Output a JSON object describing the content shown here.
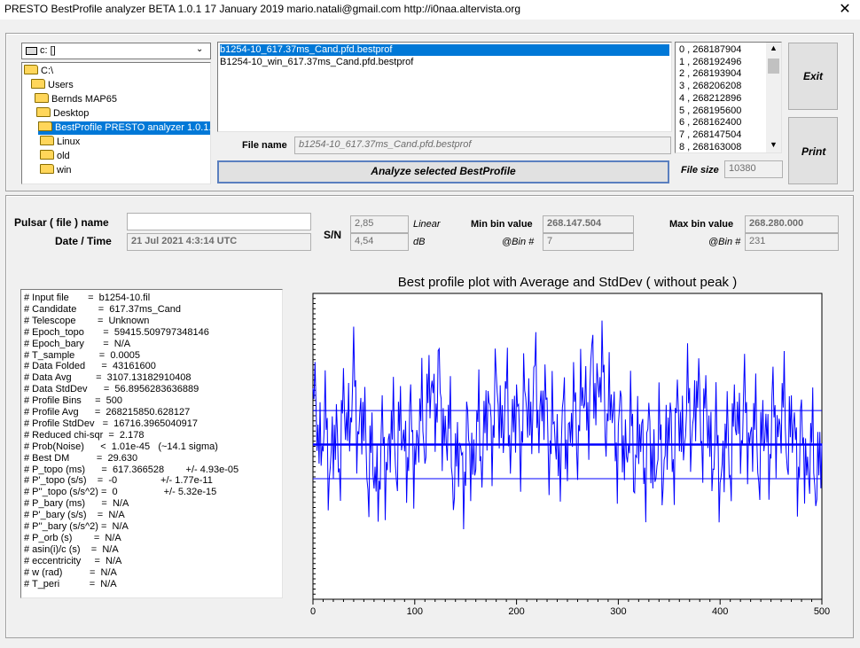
{
  "window": {
    "title": "PRESTO BestProfile analyzer BETA 1.0.1   17 January 2019       mario.natali@gmail.com       http://i0naa.altervista.org",
    "close": "✕"
  },
  "drive": {
    "value": "c: []",
    "arrow": "⌄"
  },
  "dirs": [
    {
      "label": "C:\\",
      "indent": 0,
      "selected": false
    },
    {
      "label": "Users",
      "indent": 1,
      "selected": false
    },
    {
      "label": "Bernds MAP65",
      "indent": 2,
      "selected": false
    },
    {
      "label": "Desktop",
      "indent": 3,
      "selected": false
    },
    {
      "label": "BestProfile PRESTO analyzer 1.0.1.e",
      "indent": 4,
      "selected": true
    },
    {
      "label": "Linux",
      "indent": 5,
      "selected": false
    },
    {
      "label": "old",
      "indent": 5,
      "selected": false
    },
    {
      "label": "win",
      "indent": 5,
      "selected": false
    }
  ],
  "files": [
    {
      "name": "b1254-10_617.37ms_Cand.pfd.bestprof",
      "selected": true
    },
    {
      "name": "B1254-10_win_617.37ms_Cand.pfd.bestprof",
      "selected": false
    }
  ],
  "file_name_label": "File name",
  "file_name_value": "b1254-10_617.37ms_Cand.pfd.bestprof",
  "analyze_label": "Analyze selected BestProfile",
  "file_size_label": "File size",
  "file_size_value": "10380",
  "bins": [
    "0  ,  268187904",
    "1  ,  268192496",
    "2  ,  268193904",
    "3  ,  268206208",
    "4  ,  268212896",
    "5  ,  268195600",
    "6  ,  268162400",
    "7  ,  268147504",
    "8  ,  268163008",
    "9  ,  268189296"
  ],
  "scroll_up": "▲",
  "scroll_down": "▼",
  "exit_label": "Exit",
  "print_label": "Print",
  "pulsar_label": "Pulsar ( file ) name",
  "pulsar_value": "",
  "date_label": "Date / Time",
  "date_value": "21 Jul 2021      4:3:14  UTC",
  "sn_label": "S/N",
  "sn_linear": "2,85",
  "sn_linear_unit": "Linear",
  "sn_db": "4,54",
  "sn_db_unit": "dB",
  "min_label": "Min bin value",
  "min_value": "268.147.504",
  "min_bin_label": "@Bin #",
  "min_bin": "7",
  "max_label": "Max bin value",
  "max_value": "268.280.000",
  "max_bin_label": "@Bin #",
  "max_bin": "231",
  "info": [
    "# Input file       =  b1254-10.fil",
    "# Candidate        =  617.37ms_Cand",
    "# Telescope        =  Unknown",
    "# Epoch_topo       =  59415.509797348146",
    "# Epoch_bary       =  N/A",
    "# T_sample         =  0.0005",
    "# Data Folded      =  43161600",
    "# Data Avg         =  3107.13182910408",
    "# Data StdDev      =  56.8956283636889",
    "# Profile Bins     =  500",
    "# Profile Avg      =  268215850.628127",
    "# Profile StdDev   =  16716.3965040917",
    "# Reduced chi-sqr  =  2.178",
    "# Prob(Noise)      <  1.01e-45   (~14.1 sigma)",
    "# Best DM          =  29.630",
    "# P_topo (ms)      =  617.366528        +/- 4.93e-05",
    "# P'_topo (s/s)    =  -0                +/- 1.77e-11",
    "# P''_topo (s/s^2) =  0                 +/- 5.32e-15",
    "# P_bary (ms)      =  N/A",
    "# P'_bary (s/s)    =  N/A",
    "# P''_bary (s/s^2) =  N/A",
    "# P_orb (s)        =  N/A",
    "# asin(i)/c (s)    =  N/A",
    "# eccentricity     =  N/A",
    "# w (rad)          =  N/A",
    "# T_peri           =  N/A"
  ],
  "chart_data": {
    "type": "line",
    "title": "Best profile plot with  Average and StdDev ( without peak )",
    "xlim": [
      0,
      500
    ],
    "ylim": [
      268140000,
      268290000
    ],
    "x_ticks": [
      "0",
      "100",
      "200",
      "300",
      "400",
      "500"
    ],
    "series_color": "#0000ff",
    "average": 268215850,
    "std_upper": 268232566,
    "std_lower": 268199134,
    "series": [
      {
        "x_step": 20,
        "values": [
          268230000,
          268210000,
          268240000,
          268200000,
          268220000,
          268215000,
          268245000,
          268205000,
          268215000,
          268235000,
          268225000,
          268240000,
          268215000,
          268230000,
          268250000,
          268220000,
          268215000,
          268210000,
          268225000,
          268235000,
          268205000,
          268230000,
          268215000,
          268230000,
          268212000,
          268205000
        ]
      }
    ]
  }
}
